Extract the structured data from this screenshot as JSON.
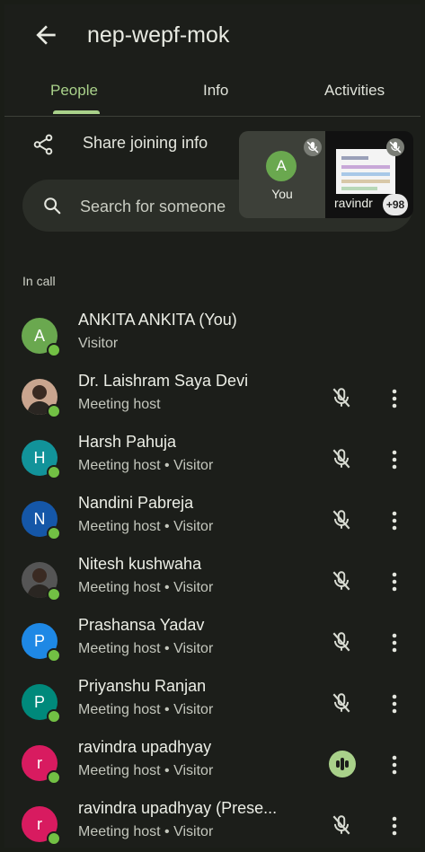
{
  "header": {
    "title": "nep-wepf-mok"
  },
  "tabs": [
    {
      "label": "People",
      "active": true
    },
    {
      "label": "Info",
      "active": false
    },
    {
      "label": "Activities",
      "active": false
    }
  ],
  "share": {
    "label": "Share joining info"
  },
  "search": {
    "placeholder": "Search for someone"
  },
  "tiles": {
    "self": {
      "initial": "A",
      "label": "You"
    },
    "presenter": {
      "label": "ravindr",
      "badge": "+98"
    }
  },
  "section": {
    "label": "In call"
  },
  "participants": [
    {
      "name": "ANKITA ANKITA (You)",
      "role": "Visitor",
      "initial": "A",
      "color": "#6aa84f",
      "mic": "none"
    },
    {
      "name": "Dr. Laishram Saya Devi",
      "role": "Meeting host",
      "initial": "",
      "color": "#c9a58f",
      "mic": "muted"
    },
    {
      "name": "Harsh Pahuja",
      "role": "Meeting host • Visitor",
      "initial": "H",
      "color": "#12939a",
      "mic": "muted"
    },
    {
      "name": "Nandini Pabreja",
      "role": "Meeting host • Visitor",
      "initial": "N",
      "color": "#1557a8",
      "mic": "muted"
    },
    {
      "name": "Nitesh kushwaha",
      "role": "Meeting host • Visitor",
      "initial": "",
      "color": "#555555",
      "mic": "muted"
    },
    {
      "name": "Prashansa Yadav",
      "role": "Meeting host • Visitor",
      "initial": "P",
      "color": "#1e88e5",
      "mic": "muted"
    },
    {
      "name": "Priyanshu Ranjan",
      "role": "Meeting host • Visitor",
      "initial": "P",
      "color": "#00897b",
      "mic": "muted"
    },
    {
      "name": "ravindra upadhyay",
      "role": "Meeting host • Visitor",
      "initial": "r",
      "color": "#d81b60",
      "mic": "speaking"
    },
    {
      "name": "ravindra upadhyay (Prese...",
      "role": "Meeting host • Visitor",
      "initial": "r",
      "color": "#d81b60",
      "mic": "muted"
    }
  ],
  "colors": {
    "accent": "#a9d18a",
    "background": "#1c1e1a",
    "online": "#72c044"
  }
}
